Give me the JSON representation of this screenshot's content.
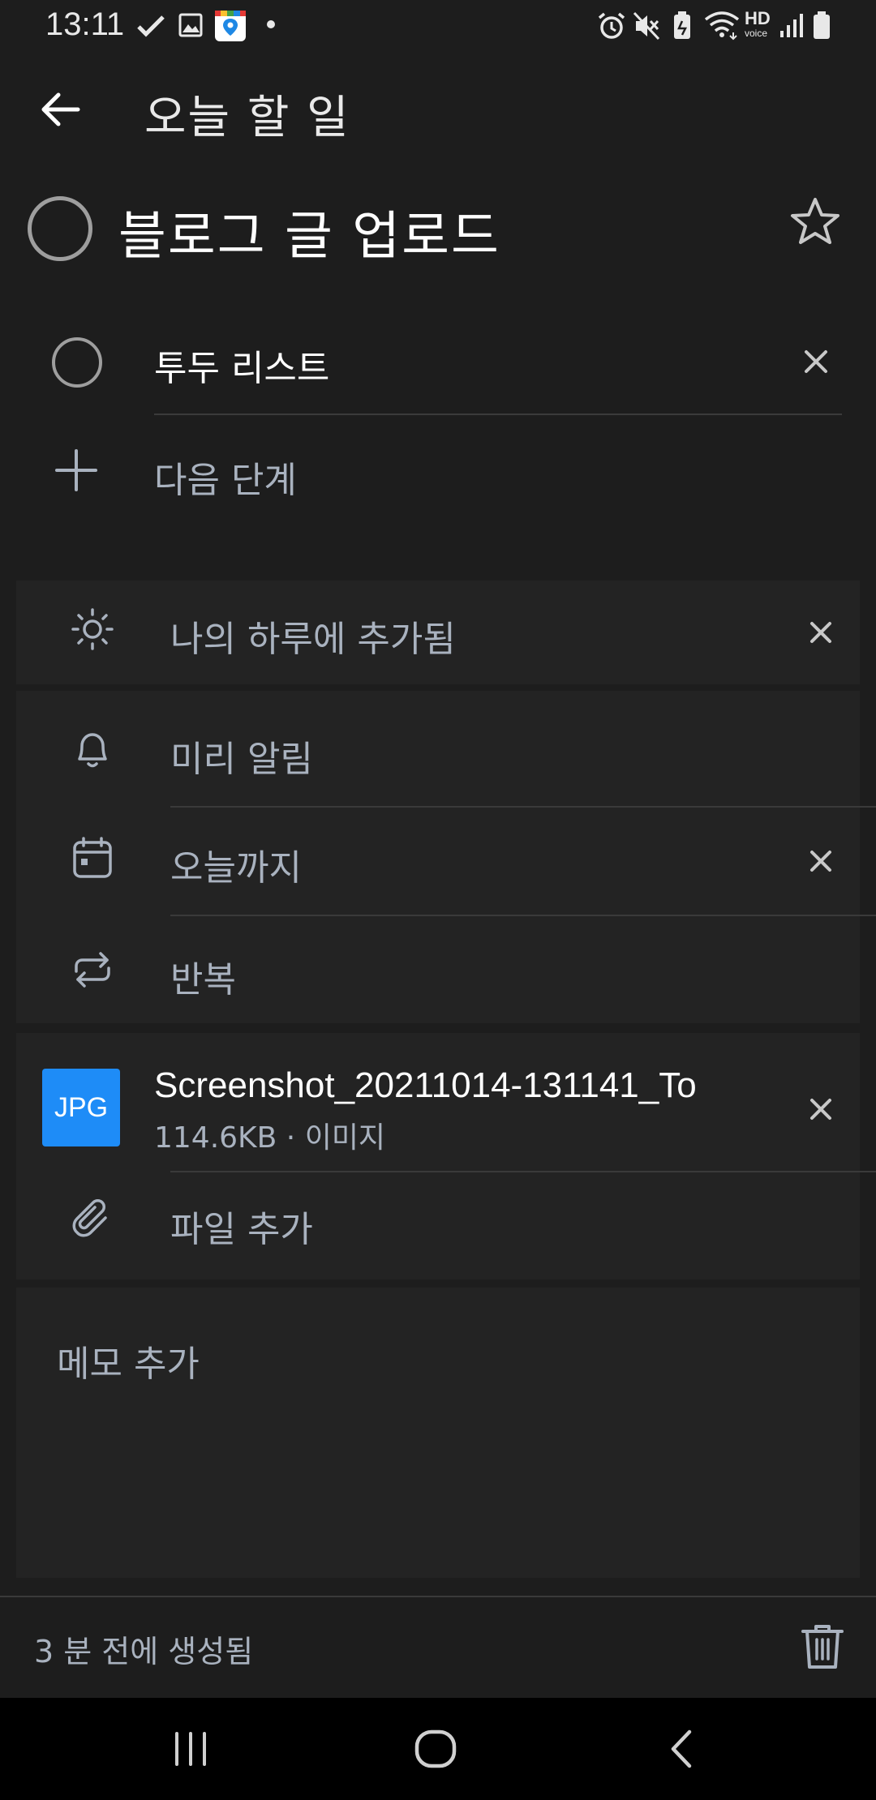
{
  "status_bar": {
    "time": "13:11",
    "icons": [
      "check-icon",
      "image-icon",
      "map-pin-app-icon",
      "dot-icon",
      "alarm-icon",
      "mute-icon",
      "battery-saver-icon",
      "wifi-icon",
      "hd-voice-icon",
      "signal-icon",
      "battery-icon"
    ],
    "hd_label": "HD",
    "voice_label": "voice"
  },
  "header": {
    "title": "오늘 할 일",
    "back_icon": "arrow-left-icon"
  },
  "task": {
    "title": "블로그 글 업로드",
    "completed": false,
    "important": false
  },
  "steps": {
    "items": [
      {
        "label": "투두 리스트",
        "completed": false
      }
    ],
    "add_label": "다음 단계"
  },
  "my_day": {
    "label": "나의 하루에 추가됨"
  },
  "options": {
    "reminder_label": "미리 알림",
    "due_label": "오늘까지",
    "repeat_label": "반복"
  },
  "files": {
    "items": [
      {
        "type_badge": "JPG",
        "name": "Screenshot_20211014-131141_To",
        "meta": "114.6KB · 이미지"
      }
    ],
    "add_label": "파일 추가"
  },
  "note": {
    "placeholder": "메모 추가"
  },
  "footer": {
    "created": "3 분 전에 생성됨"
  },
  "colors": {
    "background": "#1d1d1d",
    "card": "#232323",
    "accent_blue": "#1e8cf7",
    "secondary_text": "#a9b2bf",
    "nav_bar": "#000000"
  }
}
